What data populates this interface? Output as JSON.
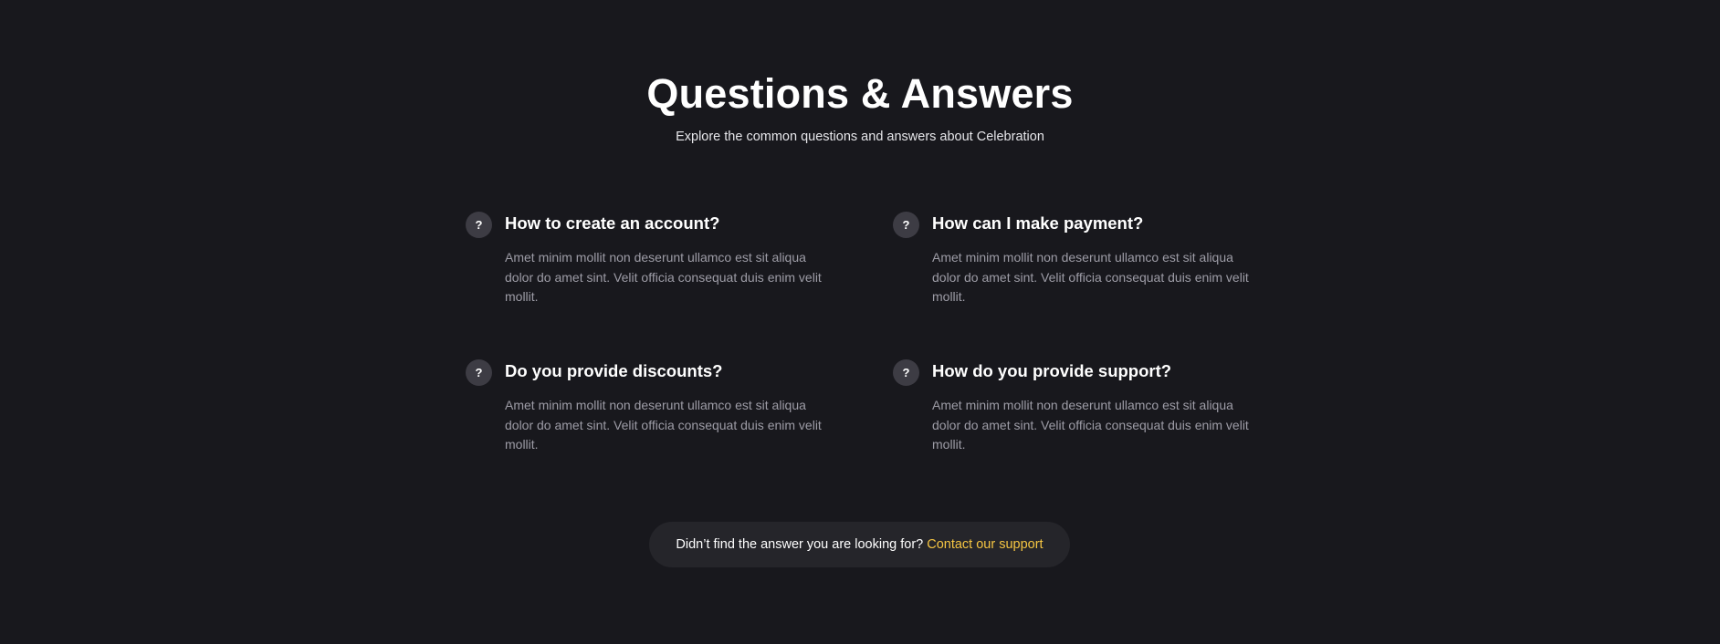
{
  "header": {
    "title": "Questions & Answers",
    "subtitle": "Explore the common questions and answers about Celebration"
  },
  "faq": {
    "icon": "question-mark-icon",
    "icon_glyph": "?",
    "items": [
      {
        "question": "How to create an account?",
        "answer": "Amet minim mollit non deserunt ullamco est sit aliqua dolor do amet sint. Velit officia consequat duis enim velit mollit."
      },
      {
        "question": "How can I make payment?",
        "answer": "Amet minim mollit non deserunt ullamco est sit aliqua dolor do amet sint. Velit officia consequat duis enim velit mollit."
      },
      {
        "question": "Do you provide discounts?",
        "answer": "Amet minim mollit non deserunt ullamco est sit aliqua dolor do amet sint. Velit officia consequat duis enim velit mollit."
      },
      {
        "question": "How do you provide support?",
        "answer": "Amet minim mollit non deserunt ullamco est sit aliqua dolor do amet sint. Velit officia consequat duis enim velit mollit."
      }
    ]
  },
  "support": {
    "text": "Didn’t find the answer you are looking for?",
    "link_label": "Contact our support"
  },
  "colors": {
    "background": "#18181d",
    "accent": "#f5c542",
    "icon_bg": "#3d3c44",
    "muted_text": "#9d9ca6"
  }
}
